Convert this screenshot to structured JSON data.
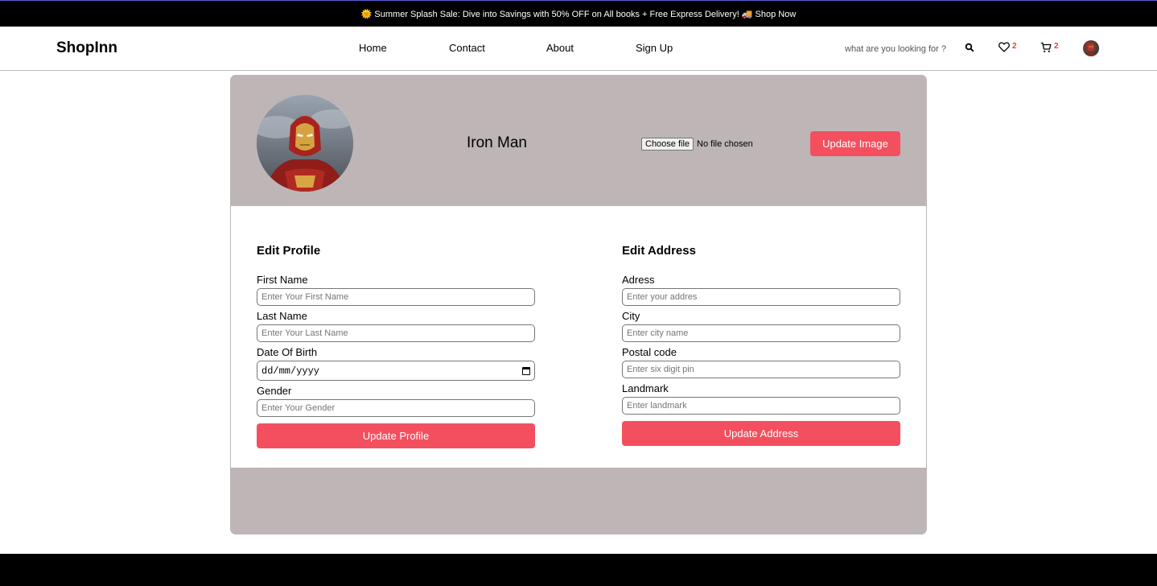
{
  "promo": {
    "text": "🌞 Summer Splash Sale: Dive into Savings with 50% OFF on All books + Free Express Delivery! 🚚 Shop Now"
  },
  "navbar": {
    "logo": "ShopInn",
    "links": [
      {
        "label": "Home"
      },
      {
        "label": "Contact"
      },
      {
        "label": "About"
      },
      {
        "label": "Sign Up"
      }
    ],
    "search_placeholder": "what are you looking for ?",
    "wishlist_count": "2",
    "cart_count": "2",
    "icons": {
      "search": "search-icon",
      "wishlist": "heart-icon",
      "cart": "cart-icon",
      "avatar": "user-avatar"
    }
  },
  "profile": {
    "name": "Iron Man",
    "file_button": "Choose file",
    "file_status": "No file chosen",
    "update_image_label": "Update Image"
  },
  "edit_profile": {
    "title": "Edit Profile",
    "fields": [
      {
        "label": "First Name",
        "placeholder": "Enter Your First Name"
      },
      {
        "label": "Last Name",
        "placeholder": "Enter Your Last Name"
      },
      {
        "label": "Date Of Birth",
        "value": "dd/mm/yyyy"
      },
      {
        "label": "Gender",
        "placeholder": "Enter Your Gender"
      }
    ],
    "submit_label": "Update Profile"
  },
  "edit_address": {
    "title": "Edit Address",
    "fields": [
      {
        "label": "Adress",
        "placeholder": "Enter your addres"
      },
      {
        "label": "City",
        "placeholder": "Enter city name"
      },
      {
        "label": "Postal code",
        "placeholder": "Enter six digit pin"
      },
      {
        "label": "Landmark",
        "placeholder": "Enter landmark"
      }
    ],
    "submit_label": "Update Address"
  },
  "colors": {
    "accent": "#f44f5e",
    "card_bg": "#bdb5b6",
    "badge": "#e0413f",
    "topbar": "#000000"
  }
}
